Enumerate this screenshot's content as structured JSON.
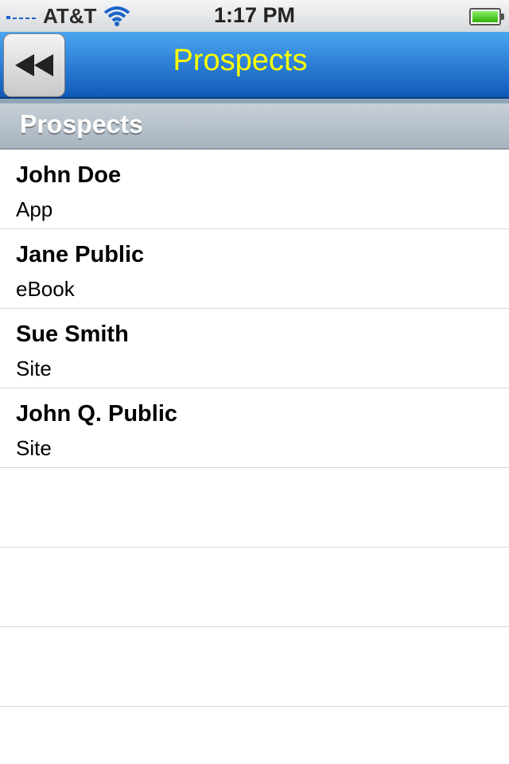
{
  "status_bar": {
    "carrier": "AT&T",
    "time": "1:17 PM",
    "icons": {
      "wifi": "wifi-icon",
      "battery": "battery-icon",
      "signal": "signal-icon"
    }
  },
  "nav": {
    "title": "Prospects",
    "back_icon": "rewind-icon",
    "title_color": "#fdff00"
  },
  "section": {
    "title": "Prospects"
  },
  "list": {
    "items": [
      {
        "name": "John Doe",
        "subtitle": "App"
      },
      {
        "name": "Jane Public",
        "subtitle": "eBook"
      },
      {
        "name": "Sue Smith",
        "subtitle": "Site"
      },
      {
        "name": "John Q. Public",
        "subtitle": "Site"
      }
    ]
  }
}
